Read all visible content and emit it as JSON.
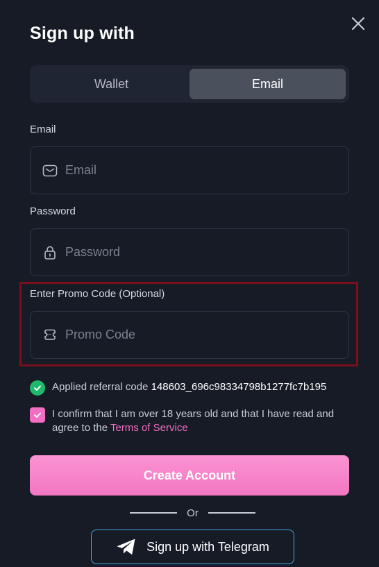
{
  "header": {
    "title": "Sign up with"
  },
  "tabs": [
    {
      "label": "Wallet",
      "active": false
    },
    {
      "label": "Email",
      "active": true
    }
  ],
  "form": {
    "email": {
      "label": "Email",
      "placeholder": "Email",
      "value": ""
    },
    "password": {
      "label": "Password",
      "placeholder": "Password",
      "value": ""
    },
    "promo": {
      "label": "Enter Promo Code (Optional)",
      "placeholder": "Promo Code",
      "value": ""
    }
  },
  "referral": {
    "prefix": "Applied referral code",
    "code": "148603_696c98334798b1277fc7b195"
  },
  "consent": {
    "text": "I confirm that I am over 18 years old and that I have read and agree to the",
    "link": "Terms of Service",
    "checked": true
  },
  "buttons": {
    "create": "Create Account",
    "or": "Or",
    "telegram": "Sign up with Telegram"
  },
  "colors": {
    "background": "#161b25",
    "accent": "#f26ec2",
    "success": "#1fb96e",
    "highlight_border": "#7a0f1d",
    "telegram_border": "#4ca7e8"
  },
  "icons": [
    "close-icon",
    "mail-icon",
    "lock-icon",
    "ticket-icon",
    "check-circle-icon",
    "checkbox-check-icon",
    "telegram-icon"
  ]
}
